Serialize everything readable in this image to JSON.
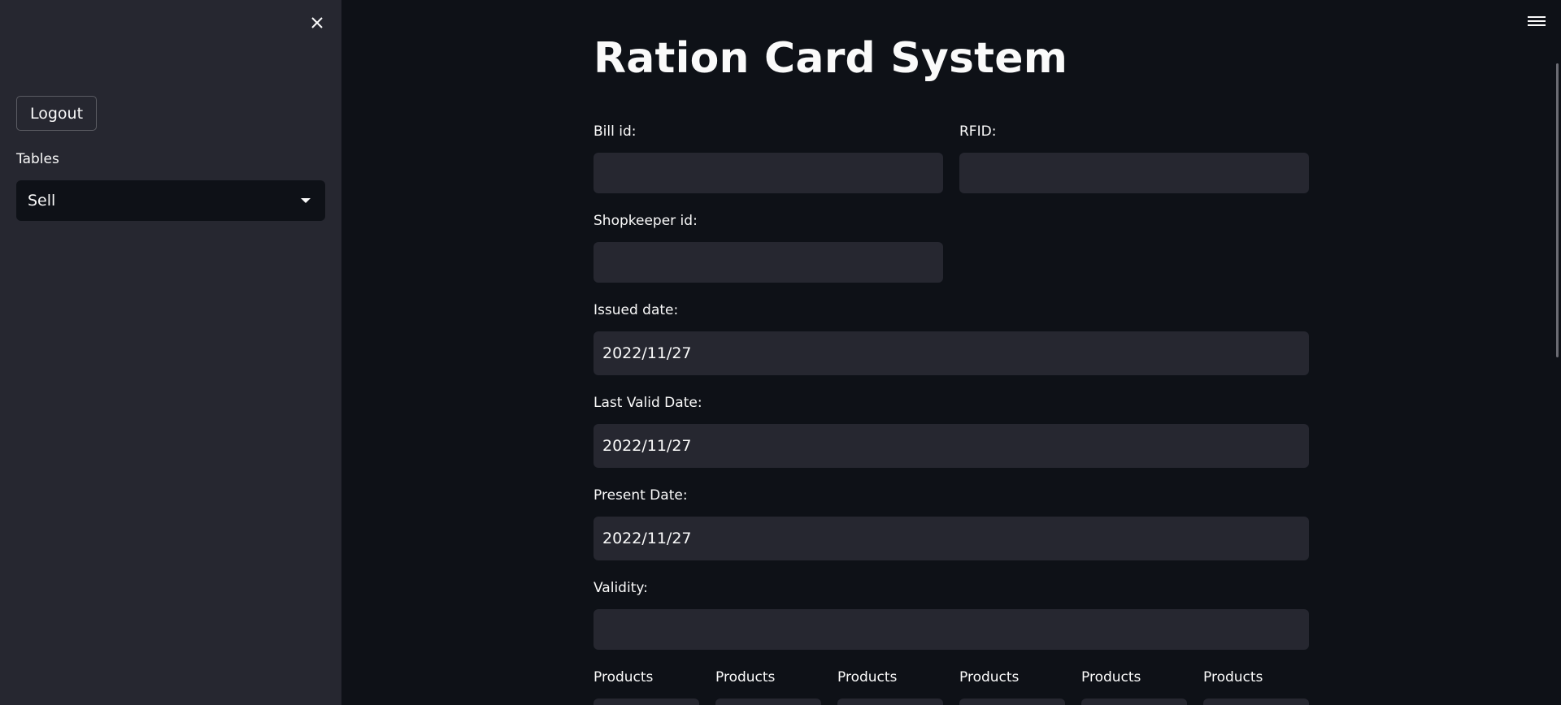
{
  "sidebar": {
    "logout_label": "Logout",
    "tables_label": "Tables",
    "tables_selected": "Sell"
  },
  "main": {
    "title": "Ration Card System",
    "fields": {
      "bill_id": {
        "label": "Bill id:",
        "value": ""
      },
      "rfid": {
        "label": "RFID:",
        "value": ""
      },
      "shopkeeper_id": {
        "label": "Shopkeeper id:",
        "value": ""
      },
      "issued_date": {
        "label": "Issued date:",
        "value": "2022/11/27"
      },
      "last_valid_date": {
        "label": "Last Valid Date:",
        "value": "2022/11/27"
      },
      "present_date": {
        "label": "Present Date:",
        "value": "2022/11/27"
      },
      "validity": {
        "label": "Validity:",
        "value": ""
      }
    },
    "products": [
      {
        "label": "Products"
      },
      {
        "label": "Products"
      },
      {
        "label": "Products"
      },
      {
        "label": "Products"
      },
      {
        "label": "Products"
      },
      {
        "label": "Products"
      }
    ]
  },
  "icons": {
    "close": "close-icon",
    "menu": "hamburger-menu-icon",
    "caret": "chevron-down-icon"
  },
  "colors": {
    "background": "#0e1117",
    "sidebar": "#262730",
    "input": "#262730",
    "text": "#fafafa"
  }
}
